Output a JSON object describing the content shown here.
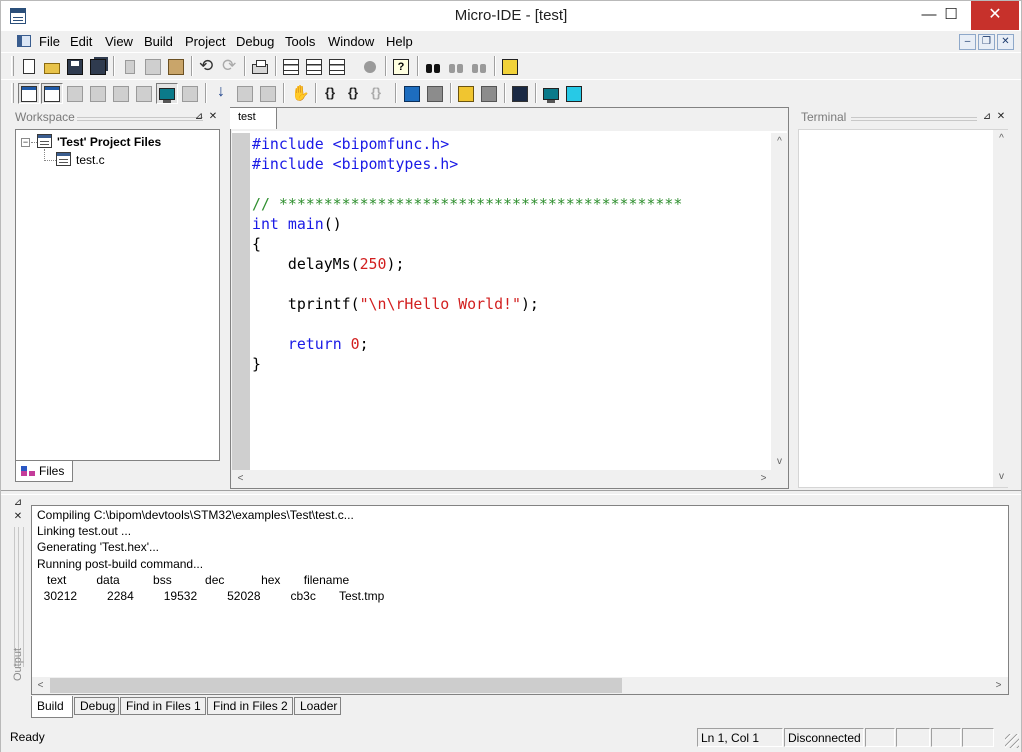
{
  "window": {
    "title": "Micro-IDE - [test]",
    "controls": {
      "minimize": "—",
      "maximize": "☐",
      "close": "✕"
    }
  },
  "menubar": {
    "items": [
      "File",
      "Edit",
      "View",
      "Build",
      "Project",
      "Debug",
      "Tools",
      "Window",
      "Help"
    ],
    "mdi_controls": {
      "minimize": "–",
      "restore": "❐",
      "close": "✕"
    }
  },
  "toolbar_row1": [
    "new-file-icon",
    "open-folder-icon",
    "save-icon",
    "save-all-icon",
    "cut-icon",
    "copy-icon",
    "paste-icon",
    "undo-icon",
    "redo-icon",
    "print-icon",
    "compile-icon",
    "build-icon",
    "rebuild-icon",
    "stop-build-icon",
    "help-icon",
    "find-icon",
    "find-next-icon",
    "find-prev-icon",
    "find-in-files-icon"
  ],
  "toolbar_row2": [
    "workspace-toggle-icon",
    "output-toggle-icon",
    "watch-icon",
    "memory-icon",
    "registers-icon",
    "disassembly-icon",
    "terminal-toggle-icon",
    "callstack-icon",
    "step-into-icon",
    "step-over-icon",
    "step-out-icon",
    "halt-icon",
    "run-to-cursor-icon",
    "go-icon",
    "go-break-icon",
    "download-icon",
    "reset-icon",
    "board-icon",
    "bookmark-icon",
    "connect-icon",
    "terminal-icon"
  ],
  "workspace": {
    "title": "Workspace",
    "controls": {
      "dock": "⊿",
      "close": "✕"
    },
    "project_label": "'Test' Project Files",
    "expander": "−",
    "files": [
      "test.c"
    ],
    "tab_label": "Files"
  },
  "editor": {
    "tab_label": "test",
    "lines": [
      [
        {
          "t": "#include <bipomfunc.h>",
          "c": "kw"
        }
      ],
      [
        {
          "t": "#include <bipomtypes.h>",
          "c": "kw"
        }
      ],
      [],
      [
        {
          "t": "// *********************************************",
          "c": "cm"
        }
      ],
      [
        {
          "t": "int",
          "c": "kw"
        },
        {
          "t": " ",
          "c": "fn"
        },
        {
          "t": "main",
          "c": "kw"
        },
        {
          "t": "()",
          "c": "fn"
        }
      ],
      [
        {
          "t": "{",
          "c": "fn"
        }
      ],
      [
        {
          "t": "    delayMs(",
          "c": "fn"
        },
        {
          "t": "250",
          "c": "num"
        },
        {
          "t": ");",
          "c": "fn"
        }
      ],
      [],
      [
        {
          "t": "    tprintf(",
          "c": "fn"
        },
        {
          "t": "\"\\n\\rHello World!\"",
          "c": "str"
        },
        {
          "t": ");",
          "c": "fn"
        }
      ],
      [],
      [
        {
          "t": "    ",
          "c": "fn"
        },
        {
          "t": "return",
          "c": "kw"
        },
        {
          "t": " ",
          "c": "fn"
        },
        {
          "t": "0",
          "c": "num"
        },
        {
          "t": ";",
          "c": "fn"
        }
      ],
      [
        {
          "t": "}",
          "c": "fn"
        }
      ]
    ]
  },
  "terminal": {
    "title": "Terminal",
    "controls": {
      "dock": "⊿",
      "close": "✕"
    }
  },
  "output": {
    "title": "Output",
    "controls": {
      "dock": "⊿",
      "close": "✕"
    },
    "lines": [
      "Compiling C:\\bipom\\devtools\\STM32\\examples\\Test\\test.c...",
      "Linking test.out ...",
      "Generating 'Test.hex'...",
      "Running post-build command...",
      "   text         data          bss          dec           hex       filename",
      "  30212         2284         19532         52028         cb3c       Test.tmp"
    ],
    "tabs": [
      "Build",
      "Debug",
      "Find in Files 1",
      "Find in Files 2",
      "Loader"
    ],
    "active_tab": "Build"
  },
  "scroll_arrows": {
    "up": "▲",
    "down": "▼",
    "left": "◀",
    "right": "▶",
    "up_chevron": "^",
    "down_chevron": "v",
    "left_chevron": "<",
    "right_chevron": ">"
  },
  "statusbar": {
    "message": "Ready",
    "position": "Ln 1, Col 1",
    "connection": "Disconnected"
  },
  "colors": {
    "keyword": "#1a1ae6",
    "comment": "#2f8f2f",
    "string": "#d21f1f",
    "close_button": "#c7312b"
  }
}
